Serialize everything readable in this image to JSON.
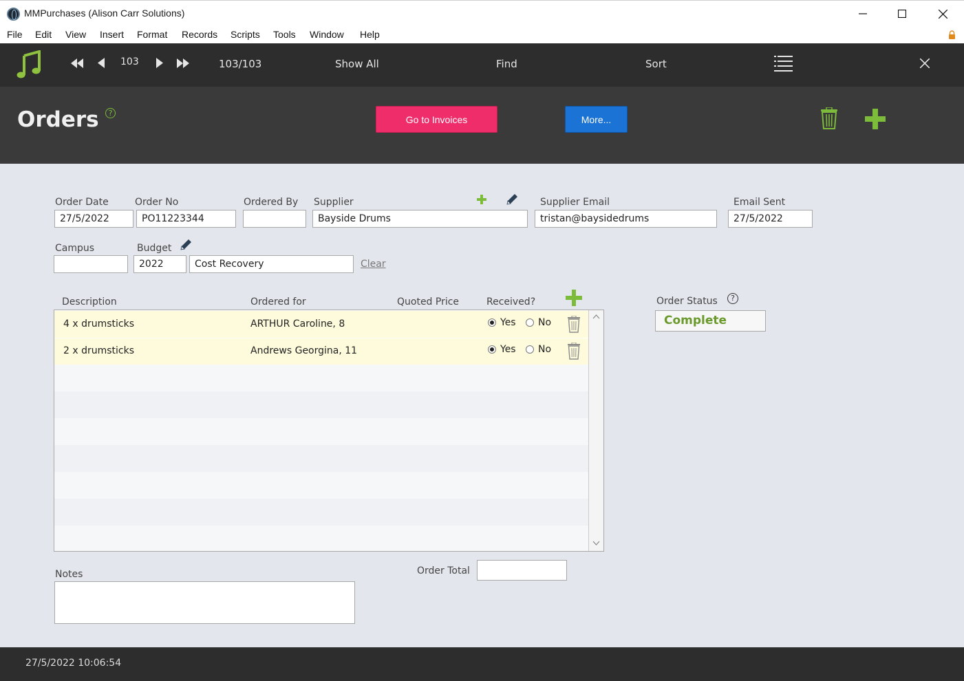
{
  "window": {
    "title": "MMPurchases (Alison Carr Solutions)",
    "minimize": "—",
    "maximize": "☐",
    "close": "✕"
  },
  "menu": [
    "File",
    "Edit",
    "View",
    "Insert",
    "Format",
    "Records",
    "Scripts",
    "Tools",
    "Window",
    "Help"
  ],
  "toolbar": {
    "record_number": "103",
    "record_count": "103/103",
    "show_all": "Show All",
    "find": "Find",
    "sort": "Sort"
  },
  "header": {
    "title": "Orders",
    "help": "?",
    "go_invoices": "Go to Invoices",
    "more": "More..."
  },
  "form": {
    "order_date_label": "Order Date",
    "order_date": "27/5/2022",
    "order_no_label": "Order No",
    "order_no": "PO11223344",
    "ordered_by_label": "Ordered By",
    "ordered_by": "",
    "supplier_label": "Supplier",
    "supplier": "Bayside Drums",
    "supplier_email_label": "Supplier Email",
    "supplier_email": "tristan@baysidedrums",
    "email_sent_label": "Email Sent",
    "email_sent": "27/5/2022",
    "campus_label": "Campus",
    "campus": "",
    "budget_label": "Budget",
    "budget_year": "2022",
    "budget_name": "Cost Recovery",
    "clear": "Clear"
  },
  "portal": {
    "headers": {
      "description": "Description",
      "ordered_for": "Ordered for",
      "quoted_price": "Quoted Price",
      "received": "Received?"
    },
    "rows": [
      {
        "description": "4 x drumsticks",
        "ordered_for": "ARTHUR Caroline, 8",
        "quoted_price": "",
        "yes": "Yes",
        "no": "No",
        "received": "Yes"
      },
      {
        "description": "2 x drumsticks",
        "ordered_for": "Andrews Georgina, 11",
        "quoted_price": "",
        "yes": "Yes",
        "no": "No",
        "received": "Yes"
      }
    ]
  },
  "order_status": {
    "label": "Order Status",
    "help": "?",
    "value": "Complete"
  },
  "notes": {
    "label": "Notes",
    "value": ""
  },
  "order_total": {
    "label": "Order Total",
    "value": ""
  },
  "footer": {
    "timestamp": "27/5/2022 10:06:54"
  },
  "colors": {
    "accent_green": "#7dbb3a",
    "pink_button": "#ef2d6a",
    "blue_button": "#1b73d6"
  }
}
